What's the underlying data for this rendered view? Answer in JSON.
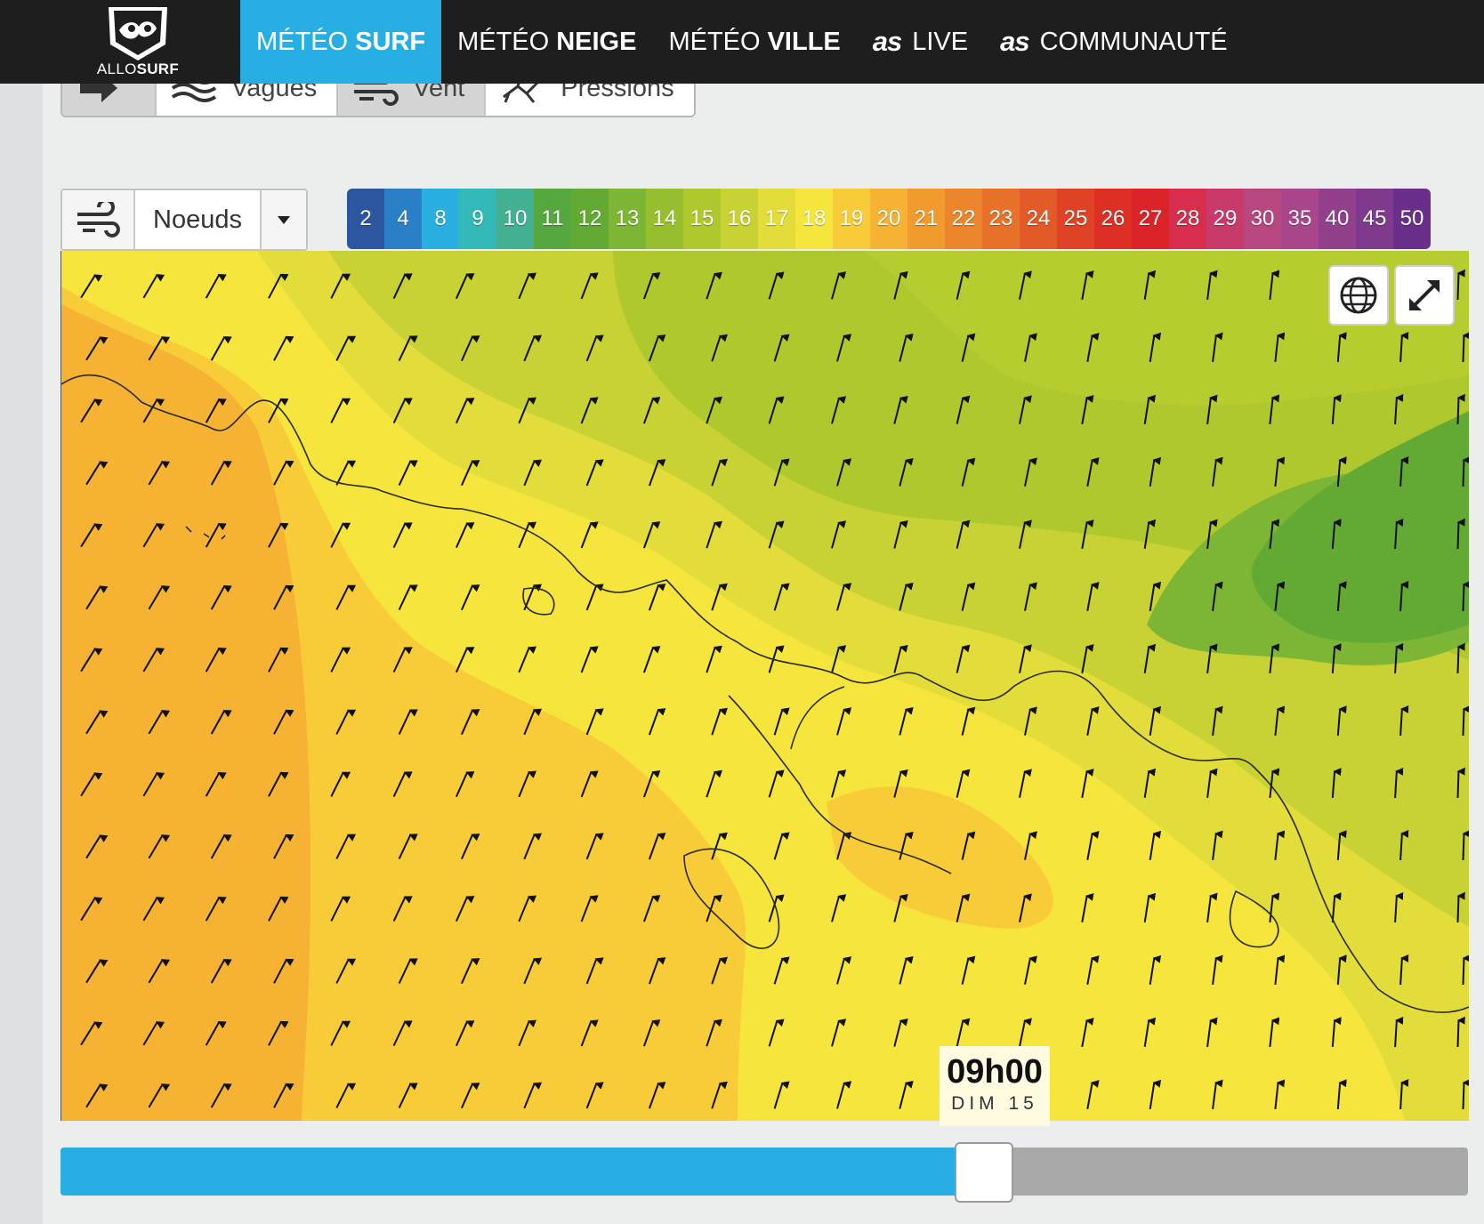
{
  "header": {
    "logo_text_light": "ALLO",
    "logo_text_bold": "SURF",
    "nav": [
      {
        "light": "MÉTÉO",
        "bold": "SURF",
        "active": true
      },
      {
        "light": "MÉTÉO",
        "bold": "NEIGE",
        "active": false
      },
      {
        "light": "MÉTÉO",
        "bold": "VILLE",
        "active": false
      },
      {
        "mark": "as",
        "light": "LIVE"
      },
      {
        "mark": "as",
        "light": "COMMUNAUTÉ"
      }
    ]
  },
  "layers": {
    "tabs": [
      {
        "icon": "arrow-icon",
        "label": ""
      },
      {
        "icon": "waves-icon",
        "label": "Vagues"
      },
      {
        "icon": "wind-icon",
        "label": "Vent"
      },
      {
        "icon": "pressure-icon",
        "label": "Pressions"
      }
    ]
  },
  "unit": {
    "icon": "wind-icon",
    "value": "Noeuds",
    "dropdown_icon": "caret-down-icon"
  },
  "legend": {
    "values": [
      "2",
      "4",
      "8",
      "9",
      "10",
      "11",
      "12",
      "13",
      "14",
      "15",
      "16",
      "17",
      "18",
      "19",
      "20",
      "21",
      "22",
      "23",
      "24",
      "25",
      "26",
      "27",
      "28",
      "29",
      "30",
      "35",
      "40",
      "45",
      "50"
    ],
    "colors": [
      "#2c57a0",
      "#2a7fc6",
      "#29b0e0",
      "#33b9b7",
      "#44b092",
      "#55a83e",
      "#62aa34",
      "#7db534",
      "#97bf2f",
      "#aec82e",
      "#c8d234",
      "#e2dd3b",
      "#f5e53c",
      "#f8cc38",
      "#f6b233",
      "#f19a2e",
      "#ec862c",
      "#e8722a",
      "#e25a27",
      "#df4325",
      "#de2f25",
      "#dc2328",
      "#d62e4c",
      "#c93a6a",
      "#b8477f",
      "#a9468c",
      "#93408c",
      "#7f398d",
      "#6a2f8a"
    ]
  },
  "map": {
    "globe_icon": "globe-icon",
    "fullscreen_icon": "expand-icon",
    "time": "09h00",
    "day": "DIM 15"
  },
  "slider": {
    "progress": 0.656
  }
}
